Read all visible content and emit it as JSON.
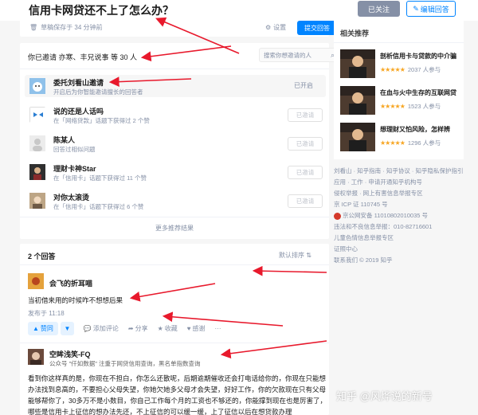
{
  "question": {
    "title": "信用卡网贷还不上了怎么办？",
    "followed_label": "已关注",
    "edit_label": "编辑回答"
  },
  "draft": {
    "status": "草稿保存于 34 分钟前",
    "settings_label": "设置",
    "submit_label": "提交回答"
  },
  "invite": {
    "header": "你已邀请 亦寒、丰兄说事 等 30 人",
    "search_placeholder": "搜索你想邀请的人",
    "rows": [
      {
        "name": "委托刘看山邀请",
        "sub": "开启后为你智能邀请擅长的回答者",
        "action": "已开启"
      },
      {
        "name": "说的还是人话吗",
        "sub": "在「网络贷款」话题下获得过 2 个赞",
        "action": "已邀请"
      },
      {
        "name": "陈某人",
        "sub": "回答过相似问题",
        "action": "已邀请"
      },
      {
        "name": "理财卡神Star",
        "sub": "在「信用卡」话题下获得过 11 个赞",
        "action": "已邀请"
      },
      {
        "name": "对你太滚烫",
        "sub": "在「信用卡」话题下获得过 6 个赞",
        "action": "已邀请"
      }
    ],
    "more_label": "更多推荐结果"
  },
  "answers": {
    "count_label": "2 个回答",
    "sort_label": "默认排序",
    "first": {
      "author": "会飞的折耳喵",
      "text": "当初借来用的时候咋不想想后果",
      "date": "发布于 11:18",
      "upvote_label": "赞同",
      "comment_label": "添加评论",
      "share_label": "分享",
      "collect_label": "收藏",
      "thanks_label": "感谢"
    },
    "second": {
      "author": "空眸浅笑-FQ",
      "sub": "公众号 \"仟如数据\" 注重于网贷信用查询，黑名单指数查询",
      "body": "看到你这样真的是，你现在不担白，你怎么还散呢，后期逾期催收还会打电话给你的，你现在只能想办法找到息高的，不要担心父母失望，你她欠她多父母才会失望，好好工作，你的欠款现在只有父母能够帮你了，30多万不是小数目，你自己工作每个月的工资也不够还的，你能撑到现在也是厉害了，哪些是信用卡上征信的想办法先还，不上征信的可以缓一缓，上了征信以后在想贷款办理"
    }
  },
  "sidebar": {
    "title": "相关推荐",
    "items": [
      {
        "title": "剖析信用卡与贷款的中介骗",
        "rating": "★★★★★",
        "meta": "2037 人参与"
      },
      {
        "title": "在血与火中生存的互联网贷",
        "rating": "★★★★★",
        "meta": "1523 人参与"
      },
      {
        "title": "想理财又怕风险，怎样辨",
        "rating": "★★★★★",
        "meta": "1296 人参与"
      }
    ]
  },
  "footer": {
    "lines": [
      "刘看山 · 知乎指南 · 知乎协议 · 知乎隐私保护指引",
      "应用 · 工作 · 申请开通知乎机构号",
      "侵权举报 · 网上有害信息举报专区",
      "京 ICP 证 110745 号",
      "京公网安备 11010802010035 号",
      "违法和不良信息举报：010-82716601",
      "儿童色情信息举报专区",
      "证照中心",
      "联系我们 © 2019 知乎"
    ]
  },
  "watermark": "知乎 @风烨说的新号",
  "colors": {
    "accent": "#0084ff",
    "star": "#f7a623",
    "arrow": "#e8192c"
  }
}
